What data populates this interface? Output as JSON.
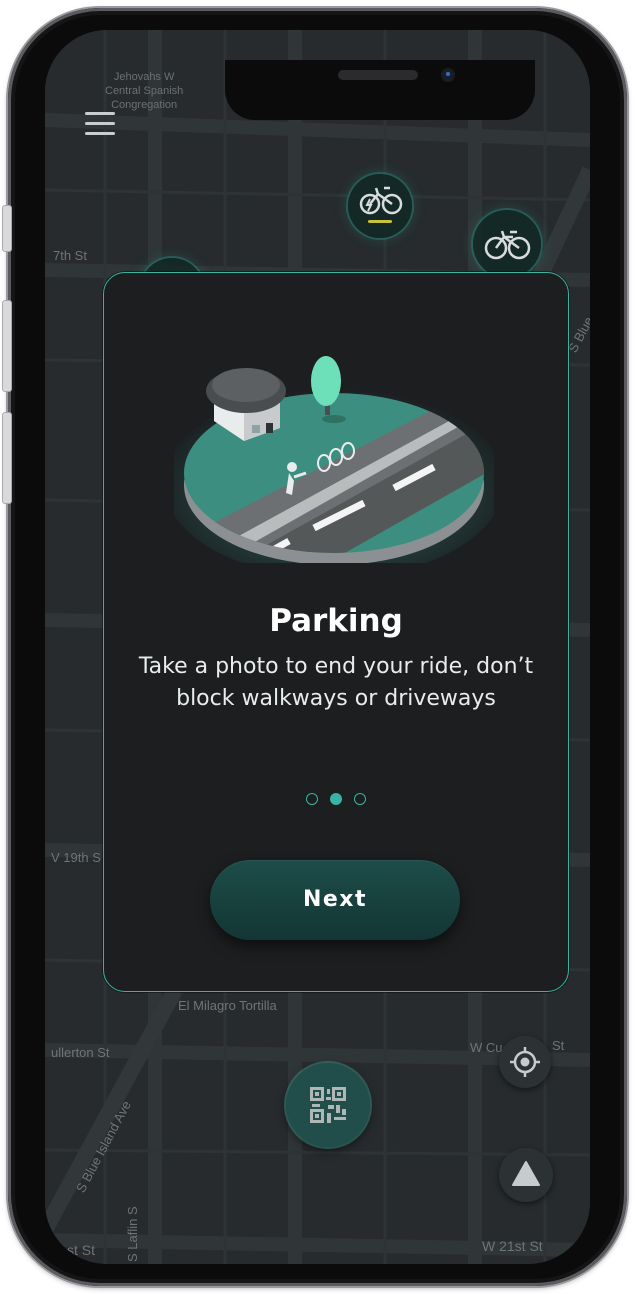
{
  "map": {
    "labels": {
      "church": "Jehovahs W\nCentral Spanish\nCongregation",
      "street_17th": "7th St",
      "street_19th": "V 19th S",
      "blue_island_right": "S Blue",
      "tortilla": "El Milagro Tortilla",
      "cullerton": "ullerton St",
      "blue_island_left": "S Blue Island Ave",
      "laflin": "S Laflin S",
      "street_bottom_left": "st St",
      "cullerton_right": "W Cu",
      "cullerton_right_st": "St",
      "street_21st": "W 21st St"
    }
  },
  "onboarding": {
    "title": "Parking",
    "description": "Take a photo to end your ride, don’t block walkways or driveways",
    "page_indicator": {
      "total": 3,
      "active": 2
    },
    "next_label": "Next"
  },
  "colors": {
    "accent": "#3ab3a0",
    "card_bg": "#1c1e20",
    "map_bg": "#262a2c",
    "button_bg": "#1d4d49"
  },
  "icons": {
    "menu": "hamburger-icon",
    "bike_marker": "bicycle-icon",
    "ebike_marker": "electric-bicycle-icon",
    "scan": "qr-code-icon",
    "locate": "crosshair-icon",
    "navigate": "triangle-icon"
  }
}
